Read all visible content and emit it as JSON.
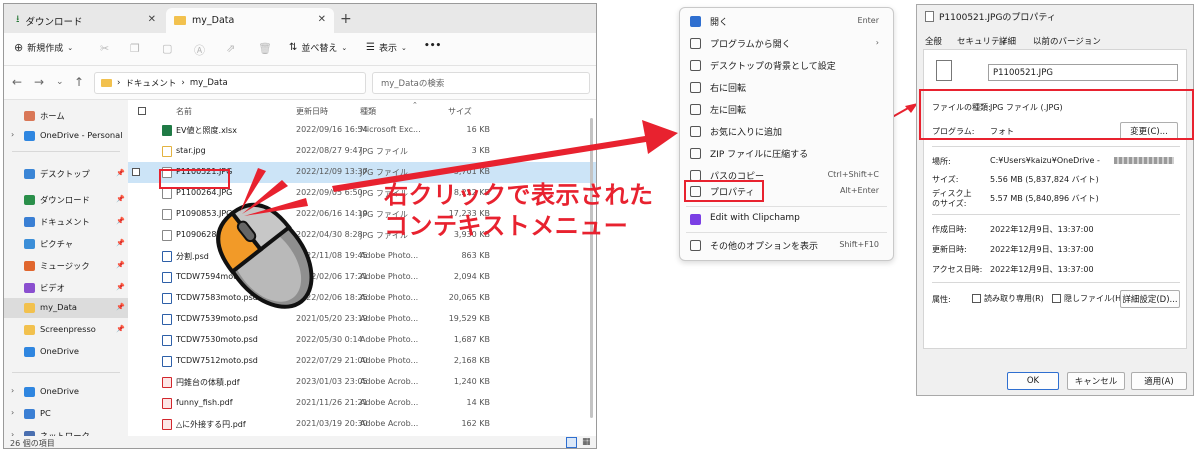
{
  "explorer": {
    "tabs": [
      {
        "label": "ダウンロード"
      },
      {
        "label": "my_Data"
      }
    ],
    "toolbar": {
      "new_label": "新規作成",
      "sort_label": "並べ替え",
      "view_label": "表示",
      "more_label": "•••"
    },
    "address": {
      "path": [
        "ドキュメント",
        "my_Data"
      ],
      "search_placeholder": "my_Dataの検索"
    },
    "sidebar": {
      "items": [
        {
          "label": "ホーム",
          "pinned": false,
          "chevron": false
        },
        {
          "label": "OneDrive - Personal",
          "pinned": false,
          "chevron": true
        },
        {
          "label": "デスクトップ",
          "pinned": true,
          "chevron": false
        },
        {
          "label": "ダウンロード",
          "pinned": true,
          "chevron": false
        },
        {
          "label": "ドキュメント",
          "pinned": true,
          "chevron": false
        },
        {
          "label": "ピクチャ",
          "pinned": true,
          "chevron": false
        },
        {
          "label": "ミュージック",
          "pinned": true,
          "chevron": false
        },
        {
          "label": "ビデオ",
          "pinned": true,
          "chevron": false
        },
        {
          "label": "my_Data",
          "pinned": true,
          "chevron": false
        },
        {
          "label": "Screenpresso",
          "pinned": true,
          "chevron": false
        },
        {
          "label": "OneDrive",
          "pinned": false,
          "chevron": false
        },
        {
          "label": "OneDrive",
          "pinned": false,
          "chevron": true
        },
        {
          "label": "PC",
          "pinned": false,
          "chevron": true
        },
        {
          "label": "ネットワーク",
          "pinned": false,
          "chevron": true
        }
      ]
    },
    "columns": {
      "name": "名前",
      "date": "更新日時",
      "type": "種類",
      "size": "サイズ"
    },
    "files": [
      {
        "name": "EV値と照度.xlsx",
        "date": "2022/09/16 16:54",
        "type": "Microsoft Exc...",
        "size": "16 KB"
      },
      {
        "name": "star.jpg",
        "date": "2022/08/27 9:47",
        "type": "JPG ファイル",
        "size": "3 KB"
      },
      {
        "name": "P1100521.JPG",
        "date": "2022/12/09 13:37",
        "type": "JPG ファイル",
        "size": "5,701 KB"
      },
      {
        "name": "P1100264.JPG",
        "date": "2022/09/05 6:50",
        "type": "JPG ファイル",
        "size": "8,222 KB"
      },
      {
        "name": "P1090853.JPG",
        "date": "2022/06/16 14:19",
        "type": "JPG ファイル",
        "size": "17,233 KB"
      },
      {
        "name": "P1090628.JPG",
        "date": "2022/04/30 8:28",
        "type": "JPG ファイル",
        "size": "3,930 KB"
      },
      {
        "name": "分割.psd",
        "date": "2022/11/08 19:45",
        "type": "Adobe Photo...",
        "size": "863 KB"
      },
      {
        "name": "TCDW7594moto.psd",
        "date": "2022/02/06 17:21",
        "type": "Adobe Photo...",
        "size": "2,094 KB"
      },
      {
        "name": "TCDW7583moto.psd",
        "date": "2022/02/06 18:25",
        "type": "Adobe Photo...",
        "size": "20,065 KB"
      },
      {
        "name": "TCDW7539moto.psd",
        "date": "2021/05/20 23:19",
        "type": "Adobe Photo...",
        "size": "19,529 KB"
      },
      {
        "name": "TCDW7530moto.psd",
        "date": "2022/05/30 0:14",
        "type": "Adobe Photo...",
        "size": "1,687 KB"
      },
      {
        "name": "TCDW7512moto.psd",
        "date": "2022/07/29 21:00",
        "type": "Adobe Photo...",
        "size": "2,168 KB"
      },
      {
        "name": "円錐台の体積.pdf",
        "date": "2023/01/03 23:05",
        "type": "Adobe Acrob...",
        "size": "1,240 KB"
      },
      {
        "name": "funny_fish.pdf",
        "date": "2021/11/26 21:21",
        "type": "Adobe Acrob...",
        "size": "14 KB"
      },
      {
        "name": "△に外接する円.pdf",
        "date": "2021/03/19 20:30",
        "type": "Adobe Acrob...",
        "size": "162 KB"
      }
    ],
    "status_text": "26 個の項目"
  },
  "context_menu": {
    "items": [
      {
        "label": "開く",
        "shortcut": "Enter",
        "icon": "open-icon",
        "color": "#2f6fd0"
      },
      {
        "label": "プログラムから開く",
        "shortcut": "›",
        "icon": "apps-icon",
        "color": "#555555"
      },
      {
        "label": "デスクトップの背景として設定",
        "shortcut": "",
        "icon": "desktop-icon",
        "color": "#555555"
      },
      {
        "label": "右に回転",
        "shortcut": "",
        "icon": "rotate-right-icon",
        "color": "#555555"
      },
      {
        "label": "左に回転",
        "shortcut": "",
        "icon": "rotate-left-icon",
        "color": "#555555"
      },
      {
        "label": "お気に入りに追加",
        "shortcut": "",
        "icon": "star-icon",
        "color": "#555555"
      },
      {
        "label": "ZIP ファイルに圧縮する",
        "shortcut": "",
        "icon": "zip-icon",
        "color": "#555555"
      },
      {
        "label": "パスのコピー",
        "shortcut": "Ctrl+Shift+C",
        "icon": "copy-path-icon",
        "color": "#555555"
      },
      {
        "label": "プロパティ",
        "shortcut": "Alt+Enter",
        "icon": "wrench-icon",
        "color": "#555555"
      },
      {
        "label": "Edit with Clipchamp",
        "shortcut": "",
        "icon": "clipchamp-icon",
        "color": "#7b3fe4"
      },
      {
        "label": "その他のオプションを表示",
        "shortcut": "Shift+F10",
        "icon": "more-options-icon",
        "color": "#555555"
      }
    ]
  },
  "properties": {
    "title": "P1100521.JPGのプロパティ",
    "tabs": [
      "全般",
      "セキュリティ",
      "詳細",
      "以前のバージョン"
    ],
    "filename": "P1100521.JPG",
    "file_type_label": "ファイルの種類:",
    "file_type_value": "JPG ファイル (.JPG)",
    "program_label": "プログラム:",
    "program_value": "フォト",
    "change_button": "変更(C)...",
    "location_label": "場所:",
    "location_value": "C:¥Users¥kaizu¥OneDrive - ",
    "size_label": "サイズ:",
    "size_value": "5.56 MB (5,837,824 バイト)",
    "disk_size_label_1": "ディスク上",
    "disk_size_label_2": "のサイズ:",
    "disk_size_value": "5.57 MB (5,840,896 バイト)",
    "created_label": "作成日時:",
    "created_value": "2022年12月9日、13:37:00",
    "modified_label": "更新日時:",
    "modified_value": "2022年12月9日、13:37:00",
    "accessed_label": "アクセス日時:",
    "accessed_value": "2022年12月9日、13:37:00",
    "attributes_label": "属性:",
    "readonly_label": "読み取り専用(R)",
    "hidden_label": "隠しファイル(H)",
    "advanced_button": "詳細設定(D)...",
    "ok_button": "OK",
    "cancel_button": "キャンセル",
    "apply_button": "適用(A)"
  },
  "annotation": {
    "line1": "右クリックで表示された",
    "line2": "コンテキストメニュー",
    "color": "#e8222f"
  }
}
